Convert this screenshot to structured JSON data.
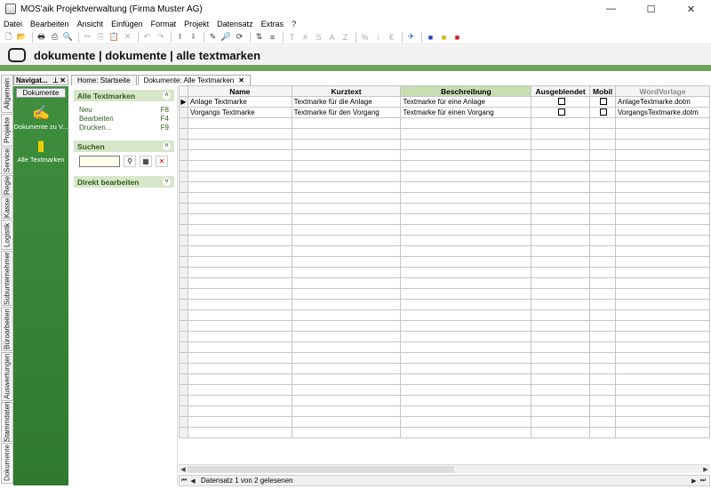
{
  "window": {
    "title": "MOS'aik Projektverwaltung (Firma Muster AG)",
    "minimize": "—",
    "maximize": "☐",
    "close": "✕"
  },
  "menu": [
    "Datei",
    "Bearbeiten",
    "Ansicht",
    "Einfügen",
    "Format",
    "Projekt",
    "Datensatz",
    "Extras",
    "?"
  ],
  "header": {
    "title": "dokumente | dokumente | alle textmarken"
  },
  "vertical_tabs": [
    "Allgemein",
    "Projekte",
    "Service",
    "Regie",
    "Kasse",
    "Logistik",
    "Subunternehmer",
    "Büroarbeiten",
    "Auswertungen",
    "Stammdaten",
    "Dokumente"
  ],
  "navigator": {
    "title": "Navigat...",
    "pin": "📌",
    "close": "✕",
    "tab": "Dokumente",
    "entries": [
      {
        "label": "Dokumente zu V...",
        "icon": "pen-document-icon"
      },
      {
        "label": "Alle Textmarken",
        "icon": "textmarker-icon"
      }
    ]
  },
  "tabs": [
    {
      "label": "Home: Startseite"
    },
    {
      "label": "Dokumente: Alle Textmarken",
      "close": "✕"
    }
  ],
  "tasks": {
    "section1": {
      "title": "Alle Textmarken",
      "items": [
        {
          "label": "Neu",
          "key": "F8"
        },
        {
          "label": "Bearbeiten",
          "key": "F4"
        },
        {
          "label": "Drucken...",
          "key": "F9"
        }
      ]
    },
    "section2": {
      "title": "Suchen",
      "search_value": ""
    },
    "section3": {
      "title": "Direkt bearbeiten"
    }
  },
  "grid": {
    "columns": [
      "Name",
      "Kurztext",
      "Beschreibung",
      "Ausgeblendet",
      "Mobil",
      "WordVorlage"
    ],
    "rows": [
      {
        "name": "Anlage Textmarke",
        "kurztext": "Textmarke für die Anlage",
        "beschreibung": "Textmarke für eine Anlage",
        "ausgeblendet": false,
        "mobil": false,
        "wordvorlage": "AnlageTextmarke.dotm"
      },
      {
        "name": "Vorgangs Textmarke",
        "kurztext": "Textmarke für den Vorgang",
        "beschreibung": "Textmarke für einen Vorgang",
        "ausgeblendet": false,
        "mobil": false,
        "wordvorlage": "VorgangsTextmarke.dotm"
      }
    ]
  },
  "status": {
    "text": "Datensatz 1 von 2 gelesenen"
  }
}
